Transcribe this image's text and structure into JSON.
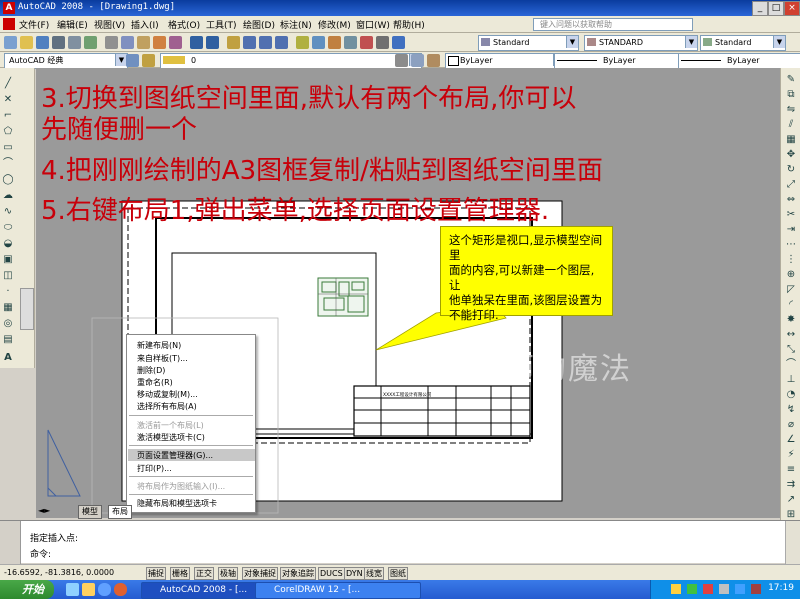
{
  "window": {
    "title": "AutoCAD 2008 - [Drawing1.dwg]",
    "help_placeholder": "键入问题以获取帮助"
  },
  "menu": [
    "文件(F)",
    "编辑(E)",
    "视图(V)",
    "插入(I)",
    "格式(O)",
    "工具(T)",
    "绘图(D)",
    "标注(N)",
    "修改(M)",
    "窗口(W)",
    "帮助(H)"
  ],
  "styles_toolbar": {
    "text_style": "Standard",
    "dim_style": "STANDARD",
    "table_style": "Standard"
  },
  "layers_toolbar": {
    "workspace": "AutoCAD 经典",
    "layer": "0",
    "color": "ByLayer",
    "linetype": "ByLayer",
    "lineweight": "ByLayer"
  },
  "instructions": [
    "3.切换到图纸空间里面,默认有两个布局,你可以",
    "先随便删一个",
    "4.把刚刚绘制的A3图框复制/粘贴到图纸空间里面",
    "5.右键布局1,弹出菜单,选择页面设置管理器."
  ],
  "callout": {
    "lines": [
      "这个矩形是视口,显示模型空间里",
      "面的内容,可以新建一个图层,让",
      "他单独呆在里面,该图层设置为",
      "不能打印."
    ]
  },
  "watermark": "亚师的魔法",
  "title_block_text": "XXXX工程设计有限公司",
  "context_menu": {
    "items": [
      {
        "label": "新建布局(N)",
        "enabled": true
      },
      {
        "label": "来自样板(T)...",
        "enabled": true
      },
      {
        "label": "删除(D)",
        "enabled": true
      },
      {
        "label": "重命名(R)",
        "enabled": true
      },
      {
        "label": "移动或复制(M)...",
        "enabled": true
      },
      {
        "label": "选择所有布局(A)",
        "enabled": true
      },
      {
        "label": "激活前一个布局(L)",
        "enabled": false
      },
      {
        "label": "激活模型选项卡(C)",
        "enabled": true
      },
      {
        "label": "页面设置管理器(G)...",
        "enabled": true,
        "selected": true
      },
      {
        "label": "打印(P)...",
        "enabled": true
      },
      {
        "label": "将布局作为图纸输入(I)...",
        "enabled": false
      },
      {
        "label": "隐藏布局和模型选项卡",
        "enabled": true
      }
    ]
  },
  "tabs": [
    "模型",
    "布局"
  ],
  "command": {
    "line1": "指定插入点:",
    "line2": "命令:"
  },
  "status": {
    "coords": "-16.6592, -81.3816, 0.0000",
    "buttons": [
      "捕捉",
      "栅格",
      "正交",
      "极轴",
      "对象捕捉",
      "对象追踪",
      "DUCS",
      "DYN",
      "线宽",
      "图纸"
    ]
  },
  "taskbar": {
    "start": "开始",
    "tasks": [
      "AutoCAD 2008 - [...",
      "CorelDRAW 12 - [..."
    ],
    "clock": "17:19"
  },
  "colors": {
    "instruction_text": "#c8000a",
    "callout_bg": "#ffff00",
    "canvas_bg": "#9a9a9a"
  }
}
